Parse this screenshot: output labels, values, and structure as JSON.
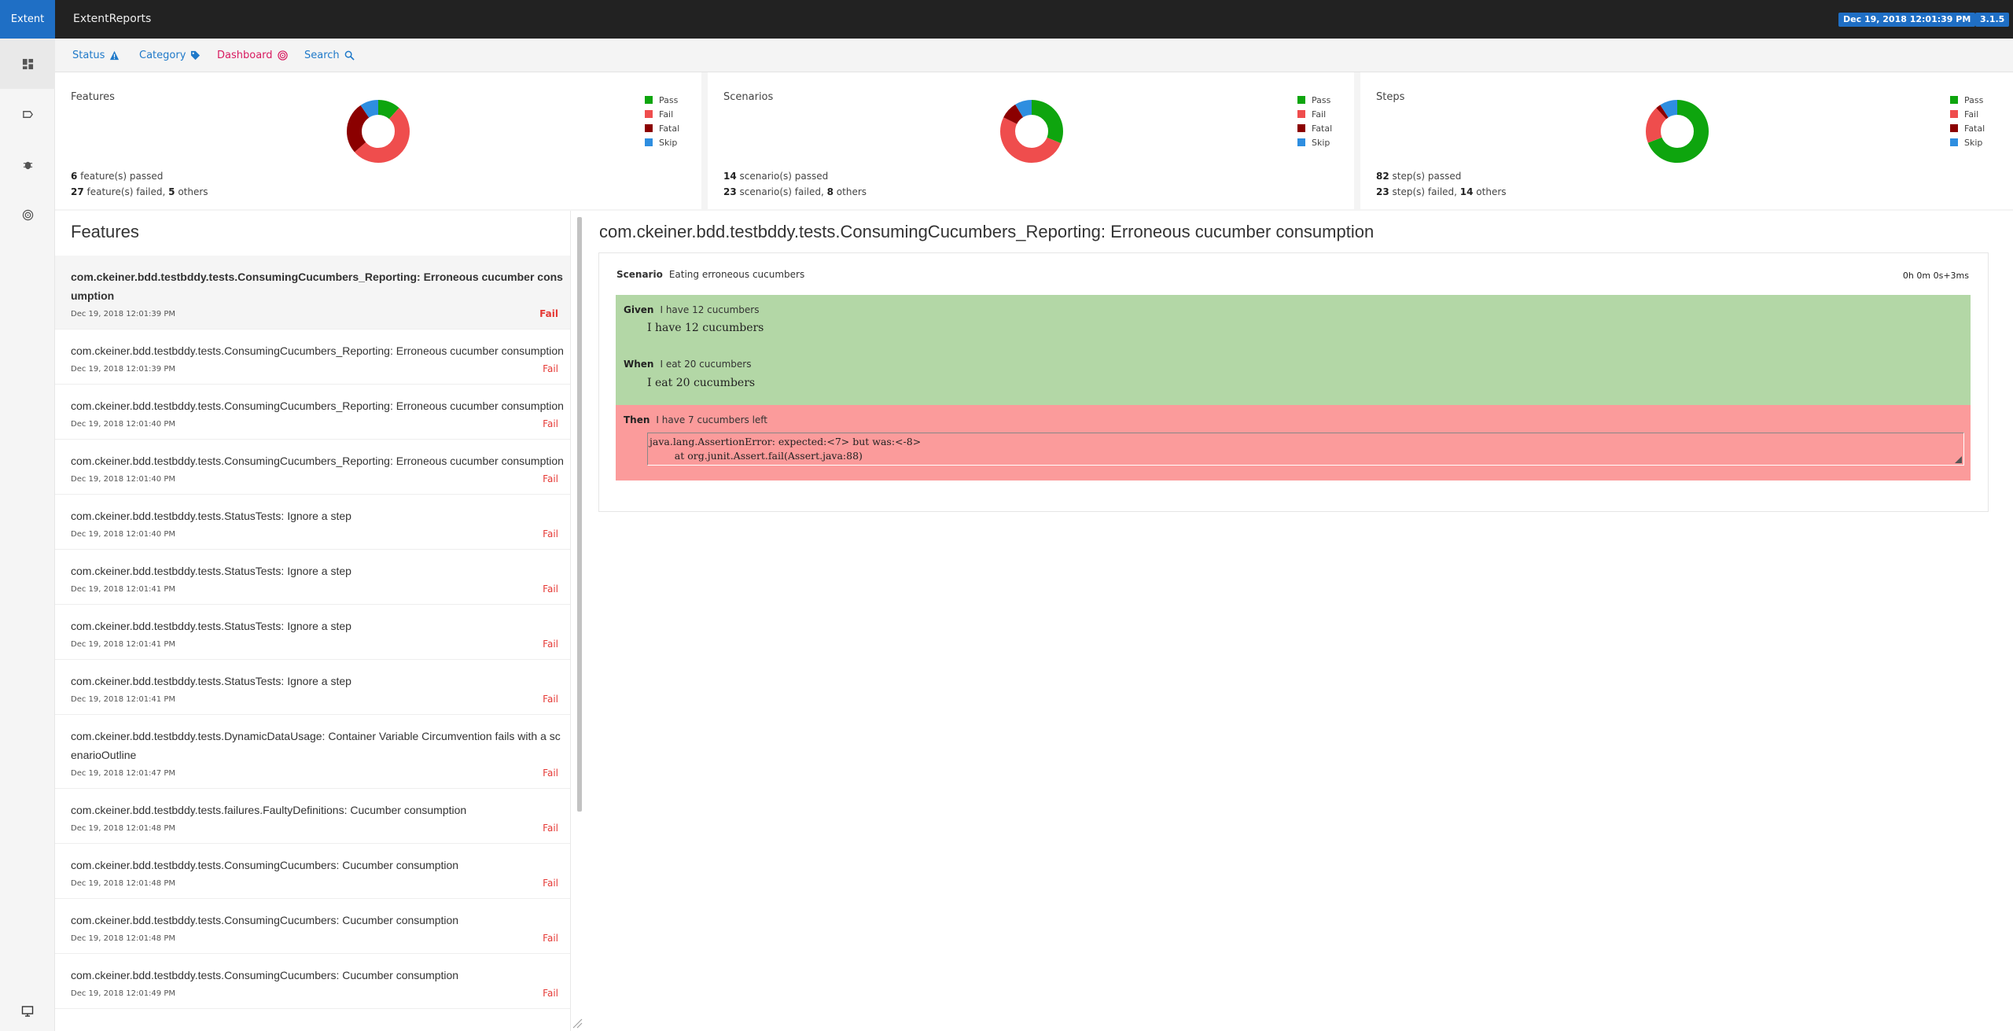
{
  "brand": "Extent",
  "header": {
    "report_name": "ExtentReports",
    "date_badge": "Dec 19, 2018 12:01:39 PM",
    "version_badge": "3.1.5"
  },
  "subnav": {
    "status": "Status",
    "category": "Category",
    "dashboard": "Dashboard",
    "search": "Search"
  },
  "colors": {
    "pass": "#0ea50e",
    "fail": "#ef4d4d",
    "fatal": "#8b0000",
    "skip": "#2e8ee0",
    "accent": "#1f6fc5"
  },
  "legend": [
    "Pass",
    "Fail",
    "Fatal",
    "Skip"
  ],
  "summary": [
    {
      "title": "Features",
      "passed_count": "6",
      "passed_text": " feature(s) passed",
      "failed_count": "27",
      "failed_text": " feature(s) failed, ",
      "others_count": "5",
      "others_text": " others",
      "chart": {
        "pass": 6,
        "fail": 27,
        "fatal": 14,
        "skip": 5
      }
    },
    {
      "title": "Scenarios",
      "passed_count": "14",
      "passed_text": " scenario(s) passed",
      "failed_count": "23",
      "failed_text": " scenario(s) failed, ",
      "others_count": "8",
      "others_text": " others",
      "chart": {
        "pass": 14,
        "fail": 23,
        "fatal": 4,
        "skip": 4
      }
    },
    {
      "title": "Steps",
      "passed_count": "82",
      "passed_text": " step(s) passed",
      "failed_count": "23",
      "failed_text": " step(s) failed, ",
      "others_count": "14",
      "others_text": " others",
      "chart": {
        "pass": 82,
        "fail": 23,
        "fatal": 3,
        "skip": 11
      }
    }
  ],
  "list": {
    "title": "Features",
    "items": [
      {
        "name": "com.ckeiner.bdd.testbddy.tests.ConsumingCucumbers_Reporting: Erroneous cucumber consumption",
        "time": "Dec 19, 2018 12:01:39 PM",
        "status": "Fail"
      },
      {
        "name": "com.ckeiner.bdd.testbddy.tests.ConsumingCucumbers_Reporting: Erroneous cucumber consumption",
        "time": "Dec 19, 2018 12:01:39 PM",
        "status": "Fail"
      },
      {
        "name": "com.ckeiner.bdd.testbddy.tests.ConsumingCucumbers_Reporting: Erroneous cucumber consumption",
        "time": "Dec 19, 2018 12:01:40 PM",
        "status": "Fail"
      },
      {
        "name": "com.ckeiner.bdd.testbddy.tests.ConsumingCucumbers_Reporting: Erroneous cucumber consumption",
        "time": "Dec 19, 2018 12:01:40 PM",
        "status": "Fail"
      },
      {
        "name": "com.ckeiner.bdd.testbddy.tests.StatusTests: Ignore a step",
        "time": "Dec 19, 2018 12:01:40 PM",
        "status": "Fail"
      },
      {
        "name": "com.ckeiner.bdd.testbddy.tests.StatusTests: Ignore a step",
        "time": "Dec 19, 2018 12:01:41 PM",
        "status": "Fail"
      },
      {
        "name": "com.ckeiner.bdd.testbddy.tests.StatusTests: Ignore a step",
        "time": "Dec 19, 2018 12:01:41 PM",
        "status": "Fail"
      },
      {
        "name": "com.ckeiner.bdd.testbddy.tests.StatusTests: Ignore a step",
        "time": "Dec 19, 2018 12:01:41 PM",
        "status": "Fail"
      },
      {
        "name": "com.ckeiner.bdd.testbddy.tests.DynamicDataUsage: Container Variable Circumvention fails with a scenarioOutline",
        "time": "Dec 19, 2018 12:01:47 PM",
        "status": "Fail"
      },
      {
        "name": "com.ckeiner.bdd.testbddy.tests.failures.FaultyDefinitions: Cucumber consumption",
        "time": "Dec 19, 2018 12:01:48 PM",
        "status": "Fail"
      },
      {
        "name": "com.ckeiner.bdd.testbddy.tests.ConsumingCucumbers: Cucumber consumption",
        "time": "Dec 19, 2018 12:01:48 PM",
        "status": "Fail"
      },
      {
        "name": "com.ckeiner.bdd.testbddy.tests.ConsumingCucumbers: Cucumber consumption",
        "time": "Dec 19, 2018 12:01:48 PM",
        "status": "Fail"
      },
      {
        "name": "com.ckeiner.bdd.testbddy.tests.ConsumingCucumbers: Cucumber consumption",
        "time": "Dec 19, 2018 12:01:49 PM",
        "status": "Fail"
      }
    ]
  },
  "detail": {
    "title": "com.ckeiner.bdd.testbddy.tests.ConsumingCucumbers_Reporting: Erroneous cucumber consumption",
    "scenario_label": "Scenario",
    "scenario_name": "Eating erroneous cucumbers",
    "duration": "0h 0m 0s+3ms",
    "steps": [
      {
        "keyword": "Given",
        "name": "I have 12 cucumbers",
        "detail": "I have 12 cucumbers"
      },
      {
        "keyword": "When",
        "name": "I eat 20 cucumbers",
        "detail": "I eat 20 cucumbers"
      },
      {
        "keyword": "Then",
        "name": "I have 7 cucumbers left"
      }
    ],
    "error_line1": "java.lang.AssertionError: expected:<7> but was:<-8>",
    "error_line2": "        at org.junit.Assert.fail(Assert.java:88)"
  }
}
